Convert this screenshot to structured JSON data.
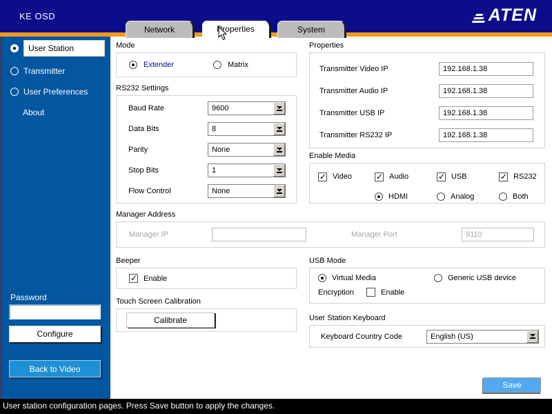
{
  "header": {
    "title": "KE OSD",
    "logo": "ATEN"
  },
  "tabs": [
    {
      "label": "Network",
      "active": false
    },
    {
      "label": "Properties",
      "active": true
    },
    {
      "label": "System",
      "active": false
    }
  ],
  "sidebar": {
    "items": [
      {
        "label": "User Station",
        "selected": true
      },
      {
        "label": "Transmitter",
        "selected": false
      },
      {
        "label": "User Preferences",
        "selected": false
      }
    ],
    "about_label": "About",
    "password_label": "Password",
    "password_value": "",
    "configure_label": "Configure",
    "back_to_video_label": "Back to Video"
  },
  "main": {
    "mode": {
      "title": "Mode",
      "options": [
        {
          "label": "Extender",
          "selected": true
        },
        {
          "label": "Matrix",
          "selected": false
        }
      ]
    },
    "rs232": {
      "title": "RS232 Settings",
      "rows": [
        {
          "label": "Baud Rate",
          "value": "9600"
        },
        {
          "label": "Data Bits",
          "value": "8"
        },
        {
          "label": "Parity",
          "value": "None"
        },
        {
          "label": "Stop Bits",
          "value": "1"
        },
        {
          "label": "Flow Control",
          "value": "None"
        }
      ]
    },
    "manager": {
      "title": "Manager Address",
      "ip_label": "Manager IP",
      "ip_value": "",
      "port_label": "Manager Port",
      "port_value": "9110",
      "disabled": true
    },
    "beeper": {
      "title": "Beeper",
      "enable_label": "Enable",
      "checked": true
    },
    "touch": {
      "title": "Touch Screen Calibration",
      "button_label": "Calibrate"
    },
    "properties": {
      "title": "Properties",
      "rows": [
        {
          "label": "Transmitter Video IP",
          "value": "192.168.1.38"
        },
        {
          "label": "Transmitter Audio IP",
          "value": "192.168.1.38"
        },
        {
          "label": "Transmitter USB IP",
          "value": "192.168.1.38"
        },
        {
          "label": "Transmitter RS232 IP",
          "value": "192.168.1.38"
        }
      ]
    },
    "enable_media": {
      "title": "Enable Media",
      "checkboxes": [
        {
          "label": "Video",
          "checked": true
        },
        {
          "label": "Audio",
          "checked": true
        },
        {
          "label": "USB",
          "checked": true
        },
        {
          "label": "RS232",
          "checked": true
        }
      ],
      "radios": [
        {
          "label": "HDMI",
          "selected": true
        },
        {
          "label": "Analog",
          "selected": false
        },
        {
          "label": "Both",
          "selected": false
        }
      ]
    },
    "usb_mode": {
      "title": "USB Mode",
      "radios": [
        {
          "label": "Virtual Media",
          "selected": true
        },
        {
          "label": "Generic USB device",
          "selected": false
        }
      ],
      "encryption_label": "Encryption",
      "encryption_enable_label": "Enable",
      "encryption_checked": false
    },
    "keyboard": {
      "title": "User Station Keyboard",
      "label": "Keyboard Country Code",
      "value": "English (US)"
    },
    "save_label": "Save"
  },
  "statusbar": {
    "text": "User station configuration pages. Press Save button to apply the changes."
  },
  "colors": {
    "header_navy": "#0d0d8c",
    "accent_orange": "#F59A1B",
    "sidebar_blue": "#0356A0",
    "action_blue": "#1E90D5",
    "save_blue": "#52A9EF",
    "tab_gray": "#bcbcbc",
    "status_black": "#000000"
  }
}
